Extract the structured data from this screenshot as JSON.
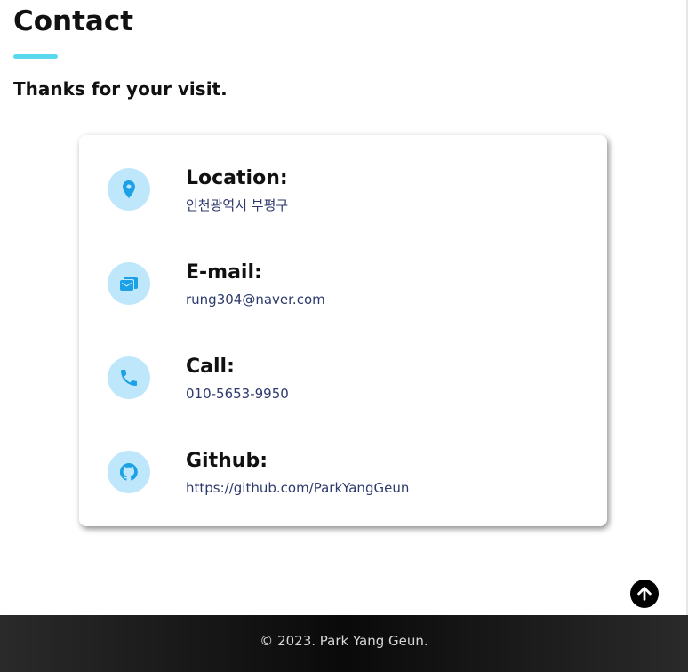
{
  "section": {
    "title": "Contact",
    "subtitle": "Thanks for your visit."
  },
  "contact_items": [
    {
      "label": "Location:",
      "value": "인천광역시 부평구",
      "icon": "location-pin-icon"
    },
    {
      "label": "E-mail:",
      "value": "rung304@naver.com",
      "icon": "mail-icon"
    },
    {
      "label": "Call:",
      "value": "010-5653-9950",
      "icon": "phone-icon"
    },
    {
      "label": "Github:",
      "value": "https://github.com/ParkYangGeun",
      "icon": "github-icon"
    }
  ],
  "scroll_top": {
    "icon": "arrow-up-icon"
  },
  "footer": {
    "text": "© 2023. Park Yang Geun."
  },
  "colors": {
    "accent": "#5ad8f0",
    "icon_bg": "#bfe7fb",
    "icon_fg": "#1da1e6",
    "value_text": "#2d3a6b"
  }
}
